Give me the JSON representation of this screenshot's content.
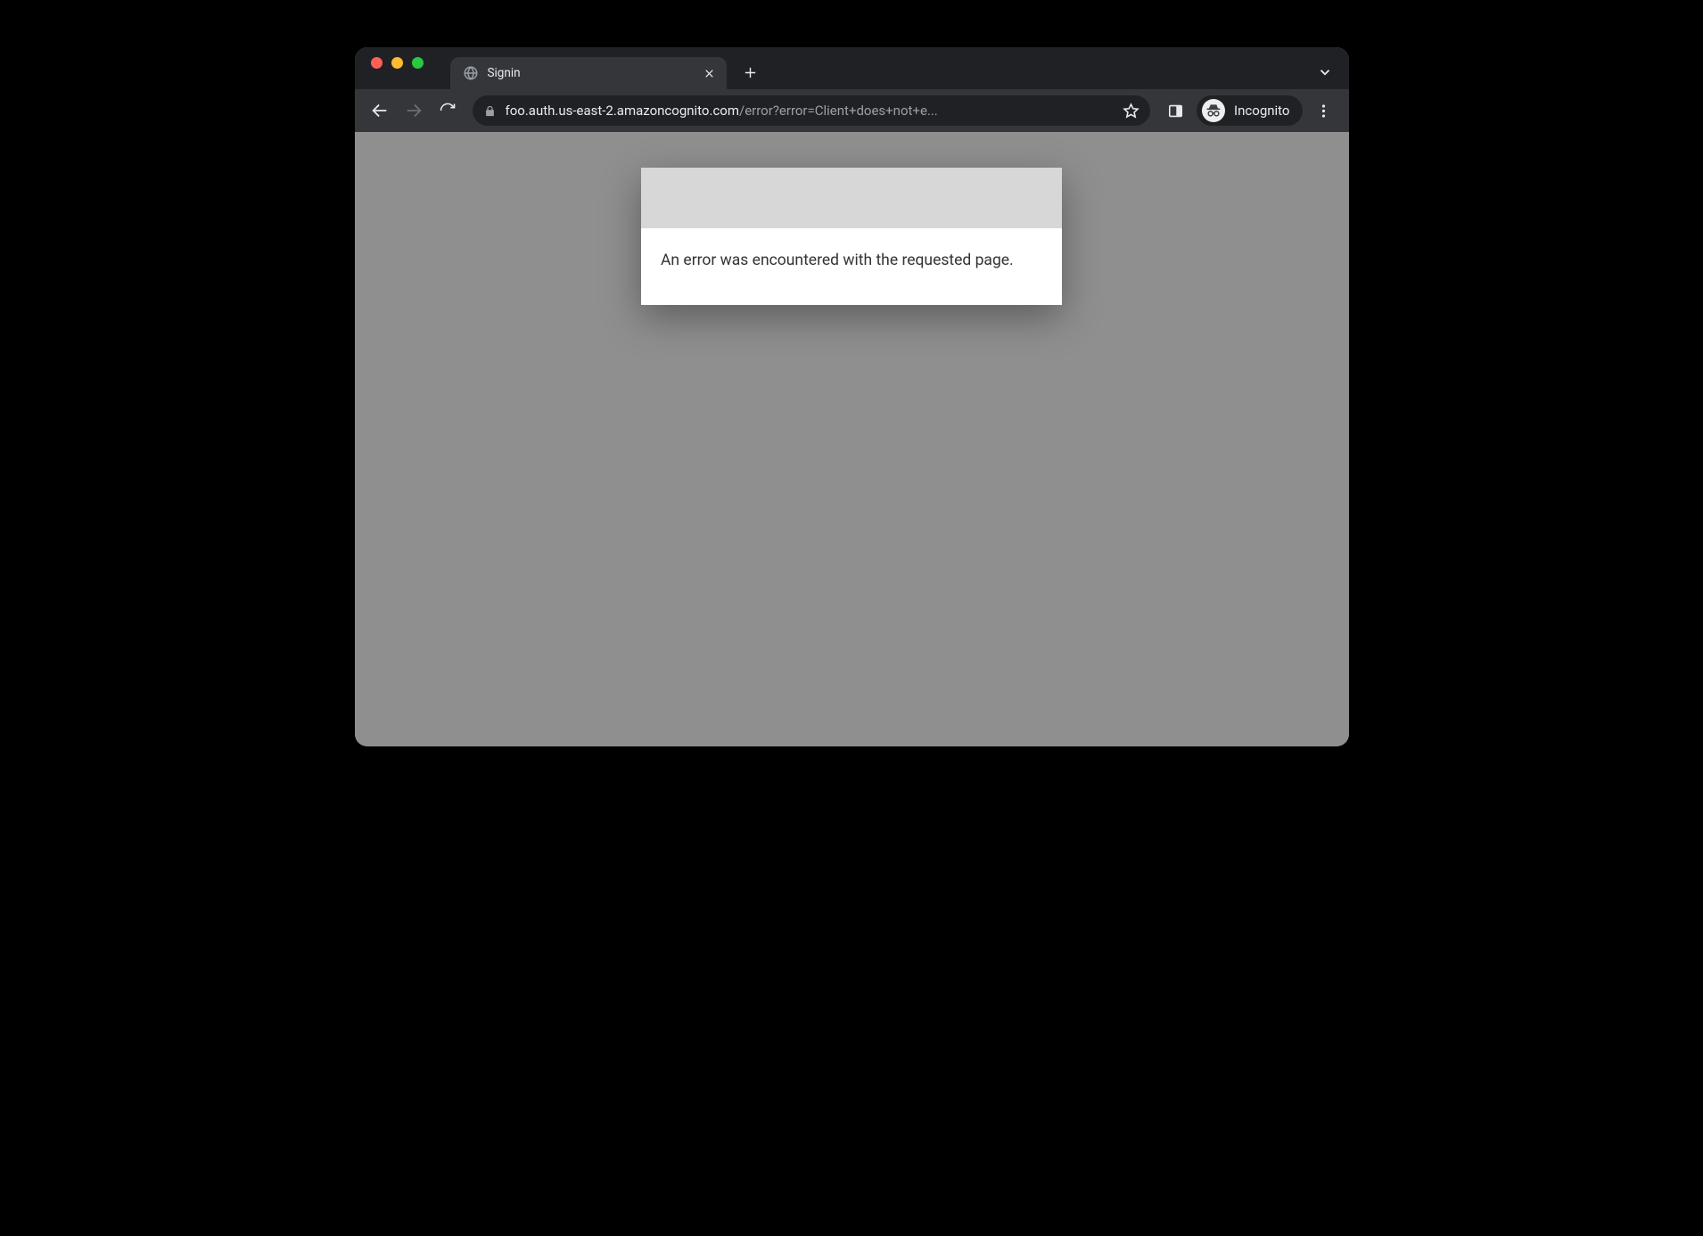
{
  "browser": {
    "tab_title": "Signin",
    "url_domain": "foo.auth.us-east-2.amazoncognito.com",
    "url_path": "/error?error=Client+does+not+e...",
    "incognito_label": "Incognito"
  },
  "page": {
    "error_message": "An error was encountered with the requested page."
  }
}
